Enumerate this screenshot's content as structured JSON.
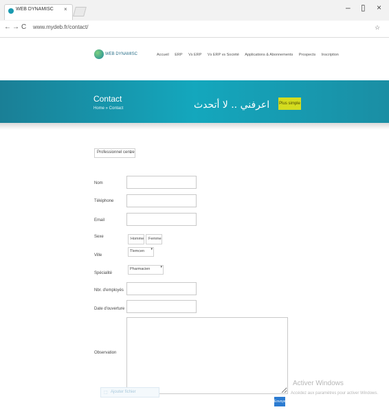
{
  "browser": {
    "tab_title": "WEB DYNAMISC",
    "tab_close": "×",
    "url": "www.mydeb.fr/contact/",
    "back": "←",
    "forward": "→",
    "reload": "C",
    "win_controls": [
      "–",
      "▯",
      "×"
    ],
    "star": "☆"
  },
  "site": {
    "logo_text": "WEB DYNAMISC",
    "menu": [
      "Accueil",
      "ERP",
      "Vs ERP",
      "Vs ERP vs Société",
      "Applications & Abonnements",
      "Prospects",
      "Inscription"
    ]
  },
  "banner": {
    "title": "Contact",
    "breadcrumb": "Home  »  Contact",
    "arabic_text": "اعرفني .. لا أتحدث",
    "plus_label": "Plus simple"
  },
  "form": {
    "top_select": "Professionnel centre",
    "labels": {
      "nom": "Nom",
      "telephone": "Téléphone",
      "email": "Email",
      "sexe": "Sexe",
      "ville": "Ville",
      "specialite": "Spécialité",
      "nbr_employes": "Nbr. d'employés",
      "date_creation": "Date d'ouverture",
      "observation": "Observation"
    },
    "sexe_options": [
      "Homme",
      "Femme"
    ],
    "ville_value": "Tlemcen",
    "specialite_value": "Pharmacien",
    "upload_label": "Ajouter fichier",
    "send_label": "Envoyer"
  },
  "watermark": {
    "title": "Activer Windows",
    "subtitle": "Accédez aux paramètres pour activer Windows."
  }
}
